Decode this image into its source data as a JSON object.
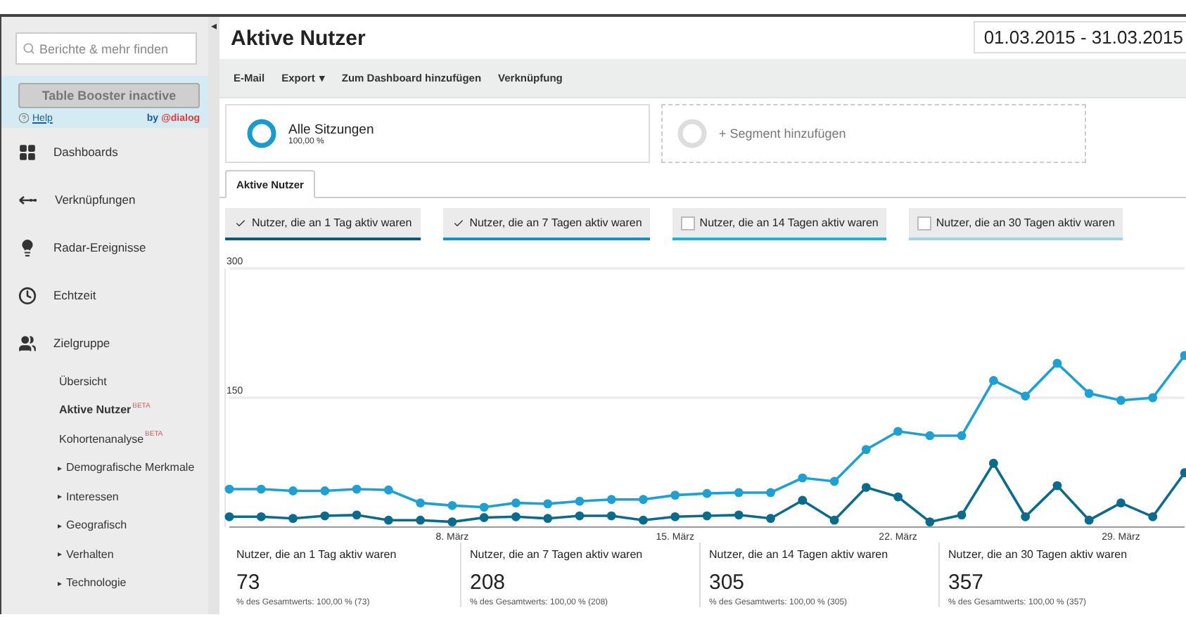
{
  "sidebar": {
    "search": {
      "placeholder": "Berichte & mehr finden"
    },
    "collapse": "◂",
    "booster": {
      "button": "Table Booster inactive",
      "help": "Help",
      "by": "by",
      "brand": "@dialog"
    },
    "items": [
      {
        "label": "Dashboards"
      },
      {
        "label": "Verknüpfungen"
      },
      {
        "label": "Radar-Ereignisse"
      },
      {
        "label": "Echtzeit"
      },
      {
        "label": "Zielgruppe",
        "children": [
          {
            "label": "Übersicht",
            "selected": false
          },
          {
            "label": "Aktive Nutzer",
            "badge": "BETA",
            "selected": true
          },
          {
            "label": "Kohortenanalyse",
            "badge": "BETA",
            "selected": false
          },
          {
            "label": "Demografische Merkmale",
            "arrow": "▸",
            "selected": false
          },
          {
            "label": "Interessen",
            "arrow": "▸",
            "selected": false
          },
          {
            "label": "Geografisch",
            "arrow": "▸",
            "selected": false
          },
          {
            "label": "Verhalten",
            "arrow": "▸",
            "selected": false
          },
          {
            "label": "Technologie",
            "arrow": "▸",
            "selected": false
          }
        ]
      }
    ]
  },
  "header": {
    "title": "Aktive Nutzer",
    "date_range": "01.03.2015 - 31.03.2015"
  },
  "toolbar": [
    {
      "label": "E-Mail"
    },
    {
      "label": "Export",
      "caret": "▾"
    },
    {
      "label": "Zum Dashboard hinzufügen"
    },
    {
      "label": "Verknüpfung"
    }
  ],
  "segments": [
    {
      "kind": "active",
      "name": "Alle Sitzungen",
      "share": "100,00 %"
    },
    {
      "kind": "add",
      "name": "+ Segment hinzufügen"
    }
  ],
  "tabs": [
    {
      "label": "Aktive Nutzer",
      "selected": true
    }
  ],
  "metrics": [
    {
      "label": "Nutzer, die an 1 Tag aktiv waren",
      "checked": true,
      "color": "#0b5a7a"
    },
    {
      "label": "Nutzer, die an 7 Tagen aktiv waren",
      "checked": true,
      "color": "#1491c9"
    },
    {
      "label": "Nutzer, die an 14 Tagen aktiv waren",
      "checked": false,
      "color": "#19b3d6"
    },
    {
      "label": "Nutzer, die an 30 Tagen aktiv waren",
      "checked": false,
      "color": "#9fd6e6"
    }
  ],
  "chart_data": {
    "type": "line",
    "x": [
      1,
      2,
      3,
      4,
      5,
      6,
      7,
      8,
      9,
      10,
      11,
      12,
      13,
      14,
      15,
      16,
      17,
      18,
      19,
      20,
      21,
      22,
      23,
      24,
      25,
      26,
      27,
      28,
      29,
      30,
      31
    ],
    "xlim": [
      1,
      31
    ],
    "ylim": [
      0,
      300
    ],
    "yticks": [
      150,
      300
    ],
    "xticks": [
      {
        "value": 8,
        "label": "8. März"
      },
      {
        "value": 15,
        "label": "15. März"
      },
      {
        "value": 22,
        "label": "22. März"
      },
      {
        "value": 29,
        "label": "29. März"
      }
    ],
    "series": [
      {
        "color": "#1ea0d2",
        "marker": "circle",
        "values": [
          44,
          44,
          42,
          42,
          44,
          43,
          28,
          25,
          23,
          28,
          27,
          30,
          32,
          32,
          37,
          39,
          40,
          40,
          57,
          53,
          90,
          111,
          106,
          106,
          170,
          152,
          190,
          155,
          147,
          150,
          199
        ]
      },
      {
        "color": "#0b6b8c",
        "marker": "circle",
        "values": [
          12,
          12,
          10,
          13,
          14,
          8,
          8,
          6,
          11,
          12,
          10,
          13,
          13,
          8,
          12,
          13,
          14,
          10,
          31,
          8,
          46,
          35,
          6,
          14,
          74,
          12,
          48,
          8,
          28,
          12,
          63
        ]
      }
    ]
  },
  "scorecards": [
    {
      "label": "Nutzer, die an 1 Tag aktiv waren",
      "value": "73",
      "total": "% des Gesamtwerts: 100,00 % (73)"
    },
    {
      "label": "Nutzer, die an 7 Tagen aktiv waren",
      "value": "208",
      "total": "% des Gesamtwerts: 100,00 % (208)"
    },
    {
      "label": "Nutzer, die an 14 Tagen aktiv waren",
      "value": "305",
      "total": "% des Gesamtwerts: 100,00 % (305)"
    },
    {
      "label": "Nutzer, die an 30 Tagen aktiv waren",
      "value": "357",
      "total": "% des Gesamtwerts: 100,00 % (357)"
    }
  ]
}
